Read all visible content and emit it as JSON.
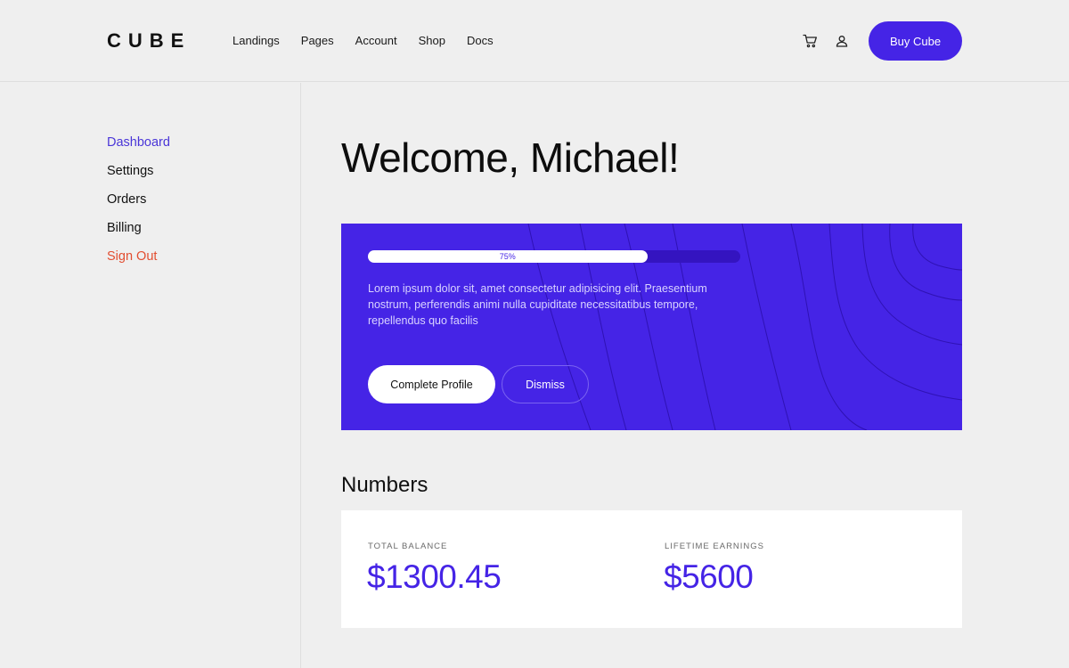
{
  "brand": {
    "logo": "CUBE",
    "accent": "#4524e6"
  },
  "nav": {
    "items": [
      "Landings",
      "Pages",
      "Account",
      "Shop",
      "Docs"
    ]
  },
  "header": {
    "cart_icon": "cart-icon",
    "user_icon": "user-icon",
    "buy_label": "Buy Cube"
  },
  "sidebar": {
    "items": [
      {
        "label": "Dashboard",
        "state": "active"
      },
      {
        "label": "Settings",
        "state": "default"
      },
      {
        "label": "Orders",
        "state": "default"
      },
      {
        "label": "Billing",
        "state": "default"
      },
      {
        "label": "Sign Out",
        "state": "danger"
      }
    ],
    "active_color": "#4a36d8",
    "danger_color": "#e24e31"
  },
  "main": {
    "welcome": "Welcome, Michael!",
    "banner": {
      "progress_percent": 75,
      "progress_label": "75%",
      "text": "Lorem ipsum dolor sit, amet consectetur adipisicing elit. Praesentium nostrum, perferendis animi nulla cupiditate necessitatibus tempore, repellendus quo facilis",
      "complete_label": "Complete Profile",
      "dismiss_label": "Dismiss"
    },
    "numbers": {
      "heading": "Numbers",
      "stats": [
        {
          "label": "TOTAL BALANCE",
          "value": "$1300.45"
        },
        {
          "label": "LIFETIME EARNINGS",
          "value": "$5600"
        }
      ]
    }
  }
}
